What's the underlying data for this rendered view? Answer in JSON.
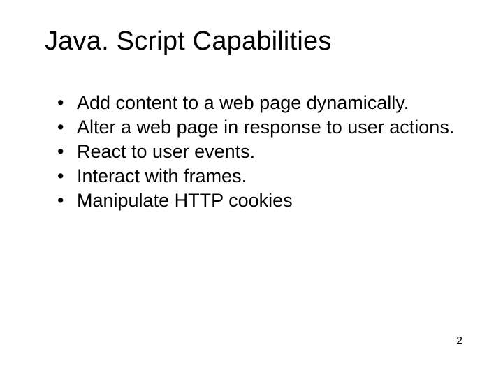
{
  "slide": {
    "title": "Java. Script Capabilities",
    "bullets": [
      "Add content to a web page dynamically.",
      "Alter a web page in response to user actions.",
      "React to user events.",
      "Interact with frames.",
      "Manipulate HTTP cookies"
    ],
    "page_number": "2"
  }
}
